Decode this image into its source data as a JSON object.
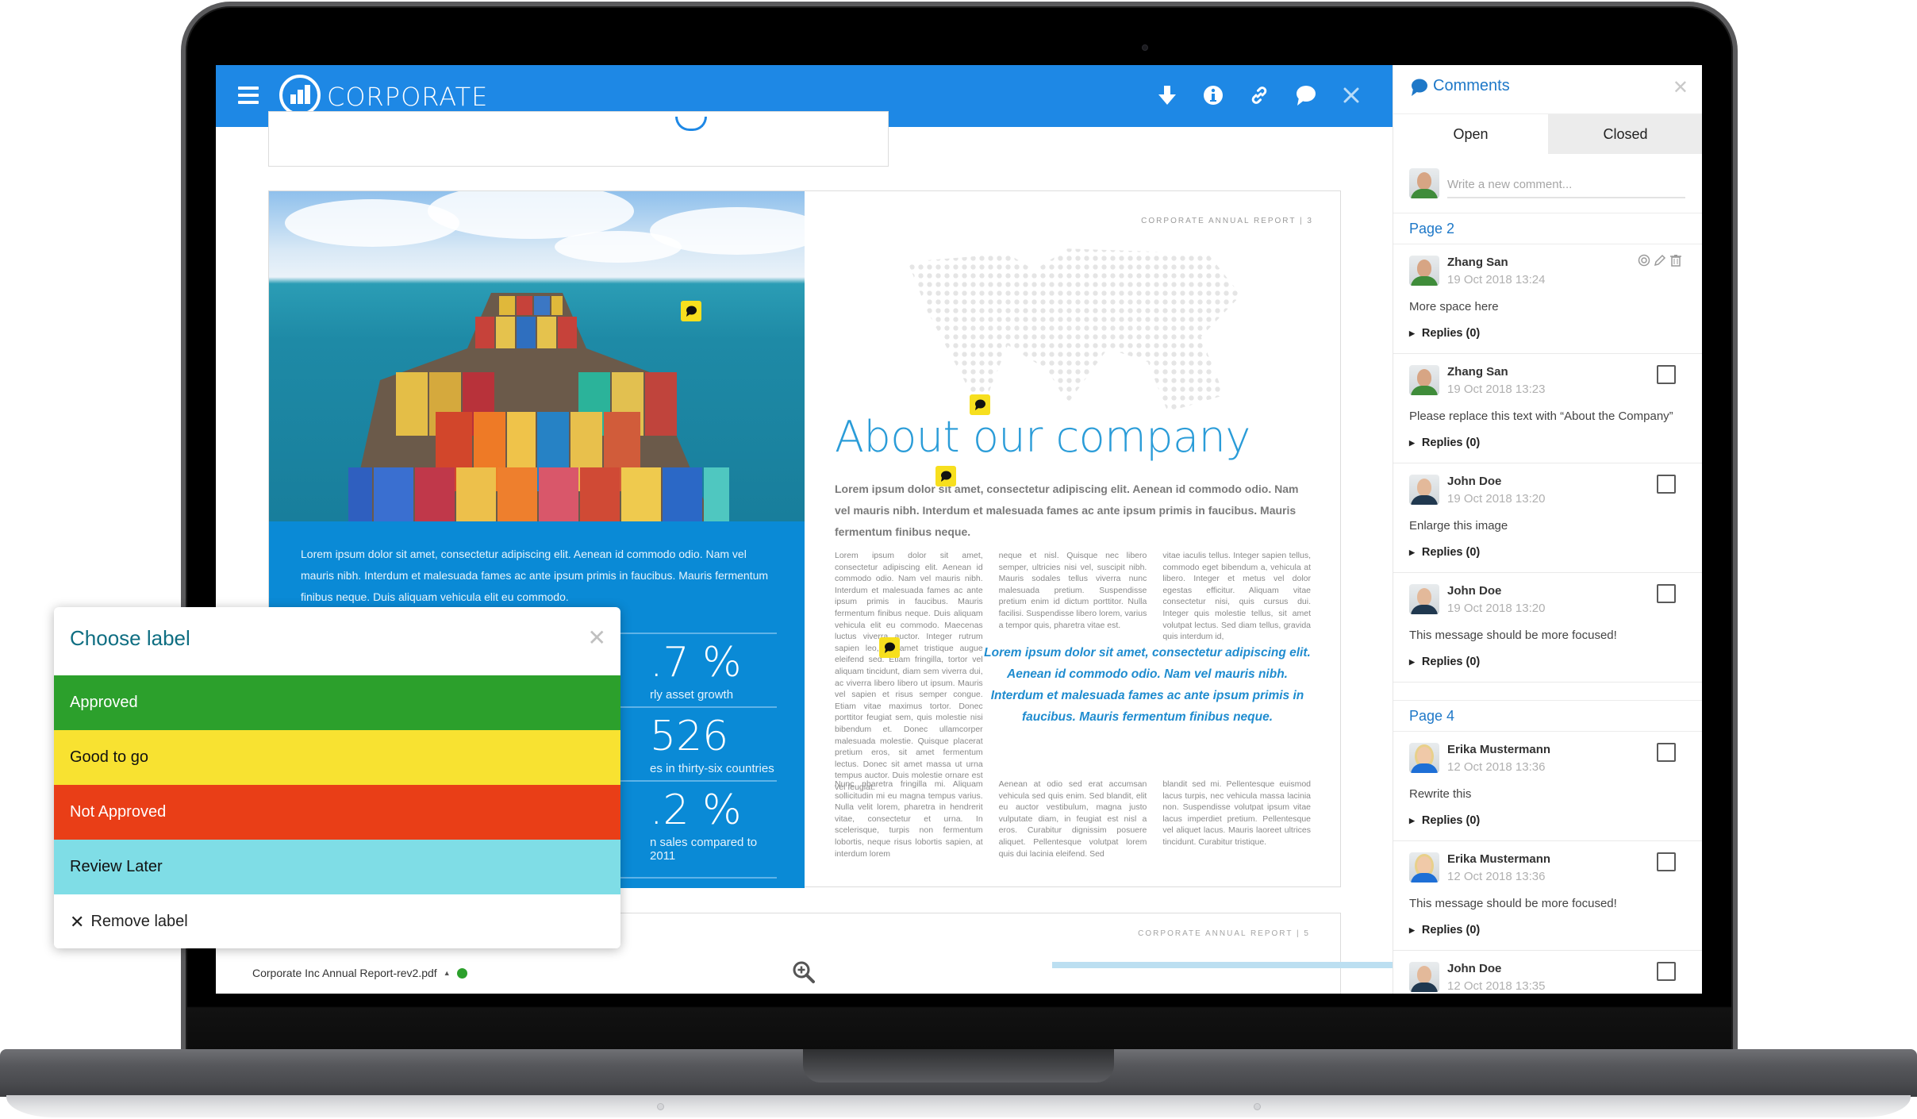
{
  "app": {
    "brand": "CORPORATE",
    "toolbar": {
      "icons": [
        "download-icon",
        "info-icon",
        "link-icon",
        "comment-icon",
        "close-icon"
      ]
    }
  },
  "document": {
    "file_name": "Corporate Inc Annual Report-rev2.pdf",
    "file_status_color": "#2ca02c",
    "page3": {
      "tag": "CORPORATE ANNUAL REPORT | 3",
      "headline": "About our company",
      "lead": "Lorem ipsum dolor sit amet, consectetur adipiscing elit. Aenean id commodo odio. Nam vel mauris nibh. Interdum et malesuada fames ac ante ipsum primis in faucibus. Mauris fermentum finibus neque.",
      "col1": "Lorem ipsum dolor sit amet, consectetur adipiscing elit. Aenean id commodo odio. Nam vel mauris nibh. Interdum et malesuada fames ac ante ipsum primis in faucibus. Mauris fermentum finibus neque. Duis aliquam vehicula elit eu commodo. Maecenas luctus viverra auctor. Integer rutrum sapien leo, sit amet tristique augue eleifend sed. Etiam fringilla, tortor vel aliquam tincidunt, diam sem viverra dui, ac viverra libero libero ut ipsum. Mauris vel sapien et risus semper congue. Etiam vitae maximus tortor. Donec porttitor feugiat sem, quis molestie nisi bibendum et. Donec ullamcorper malesuada molestie. Quisque placerat pretium eros, sit amet fermentum lectus. Donec sit amet massa ut urna tempus auctor. Duis molestie ornare est vel feugiat.",
      "col2": "neque et nisl. Quisque nec libero semper, ultricies nisi vel, suscipit nibh. Mauris sodales tellus viverra nunc malesuada pretium. Suspendisse pretium enim id dictum porttitor. Nulla facilisi. Suspendisse libero lorem, varius a tempor quis, pharetra vitae est.",
      "col3": "vitae iaculis tellus. Integer sapien tellus, commodo eget bibendum a, vehicula at libero. Integer et metus vel dolor egestas efficitur. Aliquam vitae consectetur nisi, quis cursus dui. Integer quis molestie tellus, sit amet volutpat lectus. Sed diam tellus, gravida quis interdum id,",
      "pullquote": "Lorem ipsum dolor sit amet, consectetur adipiscing elit. Aenean id commodo odio. Nam vel mauris nibh. Interdum et malesuada fames ac ante ipsum primis in faucibus. Mauris fermentum finibus neque.",
      "bottom_col1": "Nunc pharetra fringilla mi. Aliquam sollicitudin mi eu magna tempus varius. Nulla velit lorem, pharetra in hendrerit vitae, consectetur et urna. In scelerisque, turpis non fermentum lobortis, neque risus lobortis sapien, at interdum lorem",
      "bottom_col2": "Aenean at odio sed erat accumsan vehicula sed quis enim. Sed blandit, elit eu auctor vestibulum, magna justo vulputate diam, in feugiat est nisl a eros. Curabitur dignissim posuere aliquet. Pellentesque volutpat lorem quis dui lacinia eleifend. Sed",
      "bottom_col3": "blandit sed mi. Pellentesque euismod lacus turpis, nec vehicula massa lacinia non. Suspendisse volutpat ipsum vitae lacus imperdiet pretium. Pellentesque vel aliquet lacus. Mauris laoreet ultrices tincidunt. Curabitur tristique."
    },
    "page2": {
      "intro": "Lorem ipsum dolor sit amet, consectetur adipiscing elit. Aenean id commodo odio. Nam vel mauris nibh. Interdum et malesuada fames ac ante ipsum primis in faucibus. Mauris fermentum finibus neque. Duis aliquam vehicula elit eu commodo.",
      "stats": [
        {
          "value": ".7 %",
          "caption": "rly asset growth"
        },
        {
          "value": "526",
          "caption": "es in thirty-six countries"
        },
        {
          "value": ".2 %",
          "caption": "n sales compared to 2011"
        }
      ]
    },
    "page5": {
      "tag": "CORPORATE ANNUAL REPORT | 5"
    }
  },
  "comments_panel": {
    "title": "Comments",
    "tabs": [
      {
        "label": "Open",
        "active": true
      },
      {
        "label": "Closed",
        "active": false
      }
    ],
    "new_comment_placeholder": "Write a new comment...",
    "groups": [
      {
        "page_label": "Page 2",
        "items": [
          {
            "author": "Zhang San",
            "time": "19 Oct 2018 13:24",
            "message": "More space here",
            "replies": "Replies (0)",
            "avatar": "man-green",
            "show_actions": true
          },
          {
            "author": "Zhang San",
            "time": "19 Oct 2018 13:23",
            "message": "Please replace this text with “About the Company”",
            "replies": "Replies (0)",
            "avatar": "man-green",
            "show_actions": false
          },
          {
            "author": "John Doe",
            "time": "19 Oct 2018 13:20",
            "message": "Enlarge this image",
            "replies": "Replies (0)",
            "avatar": "man-navy",
            "show_actions": false
          },
          {
            "author": "John Doe",
            "time": "19 Oct 2018 13:20",
            "message": "This message should be more focused!",
            "replies": "Replies (0)",
            "avatar": "man-navy",
            "show_actions": false
          }
        ]
      },
      {
        "page_label": "Page 4",
        "items": [
          {
            "author": "Erika Mustermann",
            "time": "12 Oct 2018 13:36",
            "message": "Rewrite this",
            "replies": "Replies (0)",
            "avatar": "woman-blue",
            "show_actions": false
          },
          {
            "author": "Erika Mustermann",
            "time": "12 Oct 2018 13:36",
            "message": "This message should be more focused!",
            "replies": "Replies (0)",
            "avatar": "woman-blue",
            "show_actions": false
          },
          {
            "author": "John Doe",
            "time": "12 Oct 2018 13:35",
            "message": "",
            "replies": "",
            "avatar": "man-navy",
            "show_actions": false
          }
        ]
      }
    ]
  },
  "label_dialog": {
    "title": "Choose label",
    "options": [
      {
        "label": "Approved",
        "color": "#2ca02c",
        "text_color": "#ffffff"
      },
      {
        "label": "Good to go",
        "color": "#f8e231",
        "text_color": "#111111"
      },
      {
        "label": "Not Approved",
        "color": "#e93e17",
        "text_color": "#ffffff"
      },
      {
        "label": "Review Later",
        "color": "#7fdde6",
        "text_color": "#111111"
      }
    ],
    "remove_label": "Remove label"
  },
  "colors": {
    "brand_blue": "#1e88e5",
    "comments_accent": "#1e78c8",
    "doc_panel_blue": "#0a8ad6",
    "headline_blue": "#2a9cd8",
    "marker_yellow": "#f7df1e"
  }
}
